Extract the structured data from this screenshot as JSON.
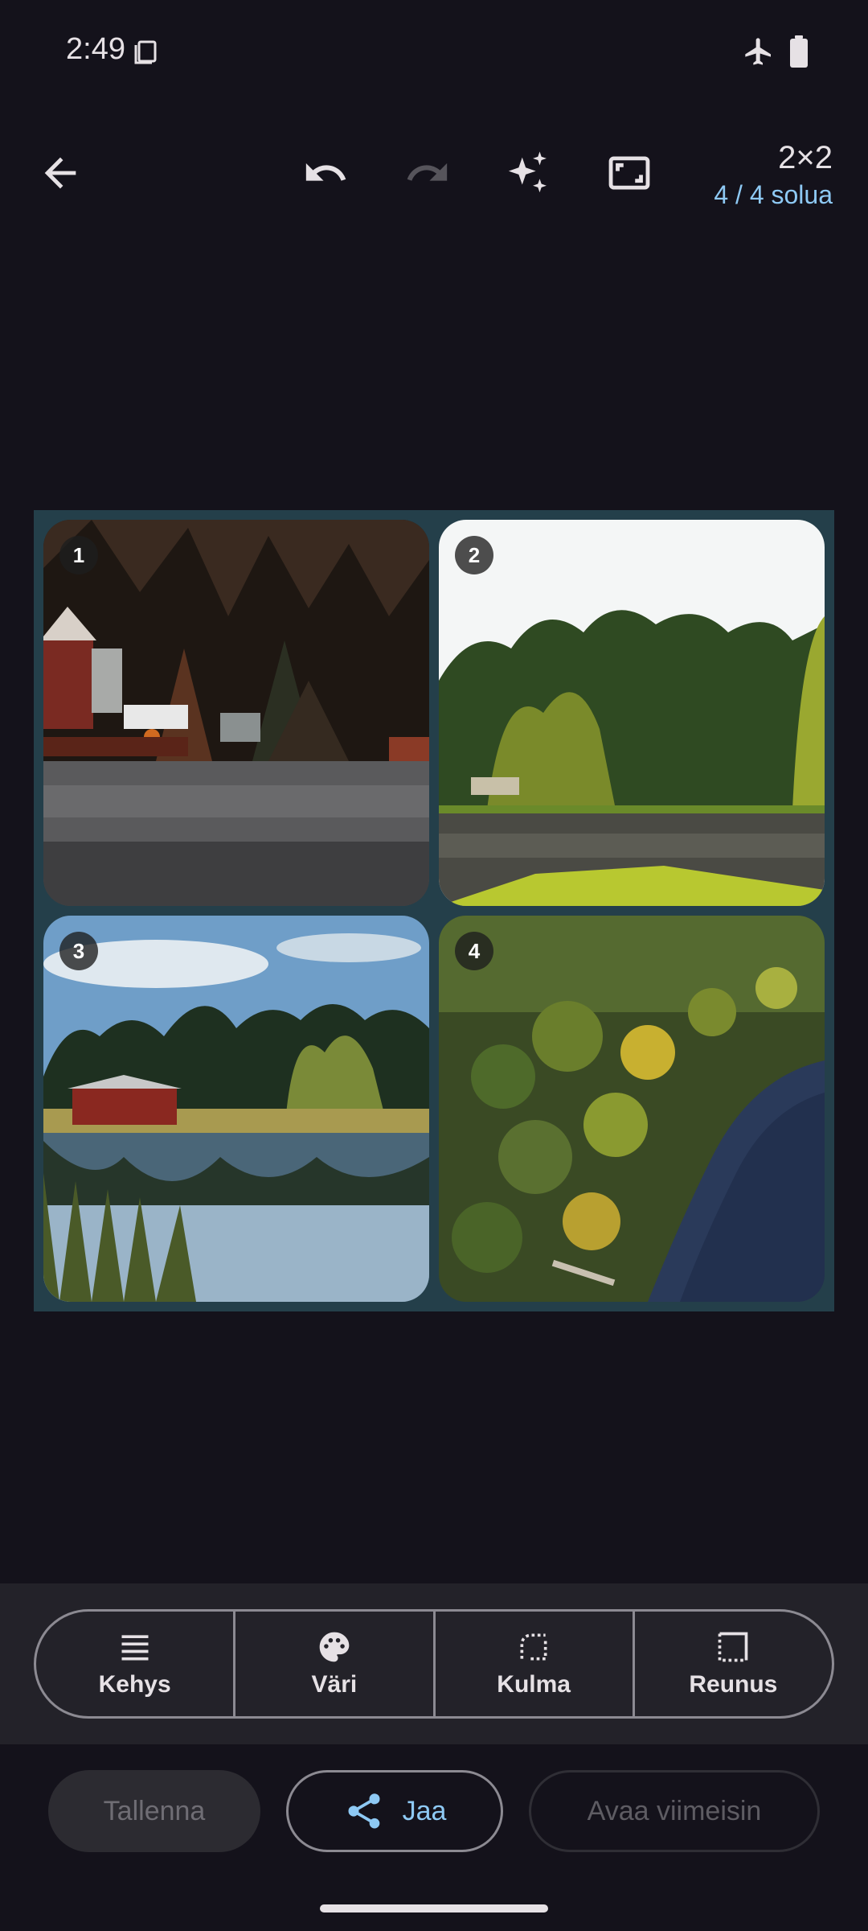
{
  "status_bar": {
    "time": "2:49"
  },
  "toolbar": {
    "grid_size": "2×2",
    "cell_count": "4 / 4 solua"
  },
  "collage": {
    "cells": [
      {
        "number": "1"
      },
      {
        "number": "2"
      },
      {
        "number": "3"
      },
      {
        "number": "4"
      }
    ]
  },
  "tools": {
    "frame_label": "Kehys",
    "color_label": "Väri",
    "corner_label": "Kulma",
    "border_label": "Reunus"
  },
  "actions": {
    "save_label": "Tallenna",
    "share_label": "Jaa",
    "open_latest_label": "Avaa viimeisin"
  },
  "colors": {
    "background": "#14121b",
    "accent": "#8ec9f4",
    "collage_border": "#243f4a",
    "panel": "#232229"
  }
}
